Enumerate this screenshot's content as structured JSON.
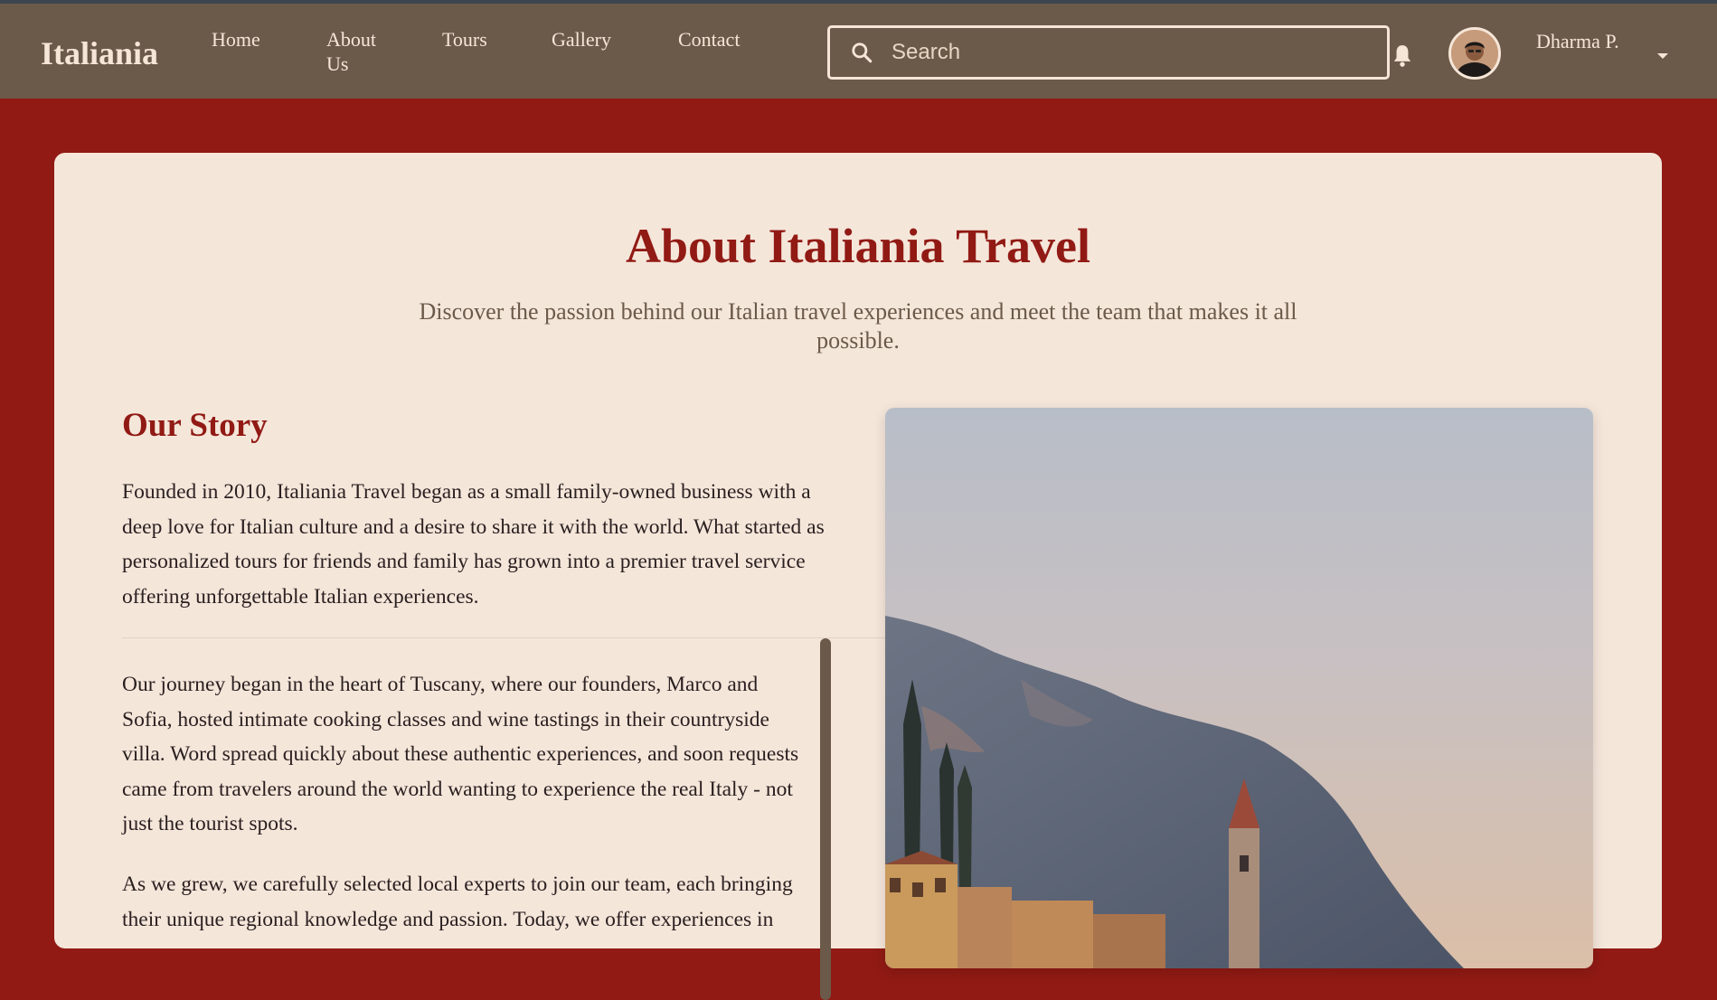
{
  "header": {
    "brand": "Italiania",
    "nav": [
      {
        "label": "Home"
      },
      {
        "label": "About Us"
      },
      {
        "label": "Tours"
      },
      {
        "label": "Gallery"
      },
      {
        "label": "Contact"
      }
    ],
    "search": {
      "placeholder": "Search",
      "value": ""
    },
    "user": {
      "name": "Dharma P."
    },
    "icons": {
      "search": "search-icon",
      "bell": "bell-icon",
      "caret": "caret-down-icon"
    }
  },
  "main": {
    "title": "About Italiania Travel",
    "subtitle": "Discover the passion behind our Italian travel experiences and meet the team that makes it all possible.",
    "story": {
      "heading": "Our Story",
      "paragraphs": [
        "Founded in 2010, Italiania Travel began as a small family-owned business with a deep love for Italian culture and a desire to share it with the world. What started as personalized tours for friends and family has grown into a premier travel service offering unforgettable Italian experiences.",
        "Our journey began in the heart of Tuscany, where our founders, Marco and Sofia, hosted intimate cooking classes and wine tastings in their countryside villa. Word spread quickly about these authentic experiences, and soon requests came from travelers around the world wanting to experience the real Italy - not just the tourist spots.",
        "As we grew, we carefully selected local experts to join our team, each bringing their unique regional knowledge and passion. Today, we offer experiences in"
      ]
    }
  },
  "colors": {
    "header_bg": "#6b5a49",
    "page_bg": "#911a14",
    "card_bg": "#f5e6da",
    "accent": "#911a14",
    "header_text": "#f5e6d8"
  }
}
